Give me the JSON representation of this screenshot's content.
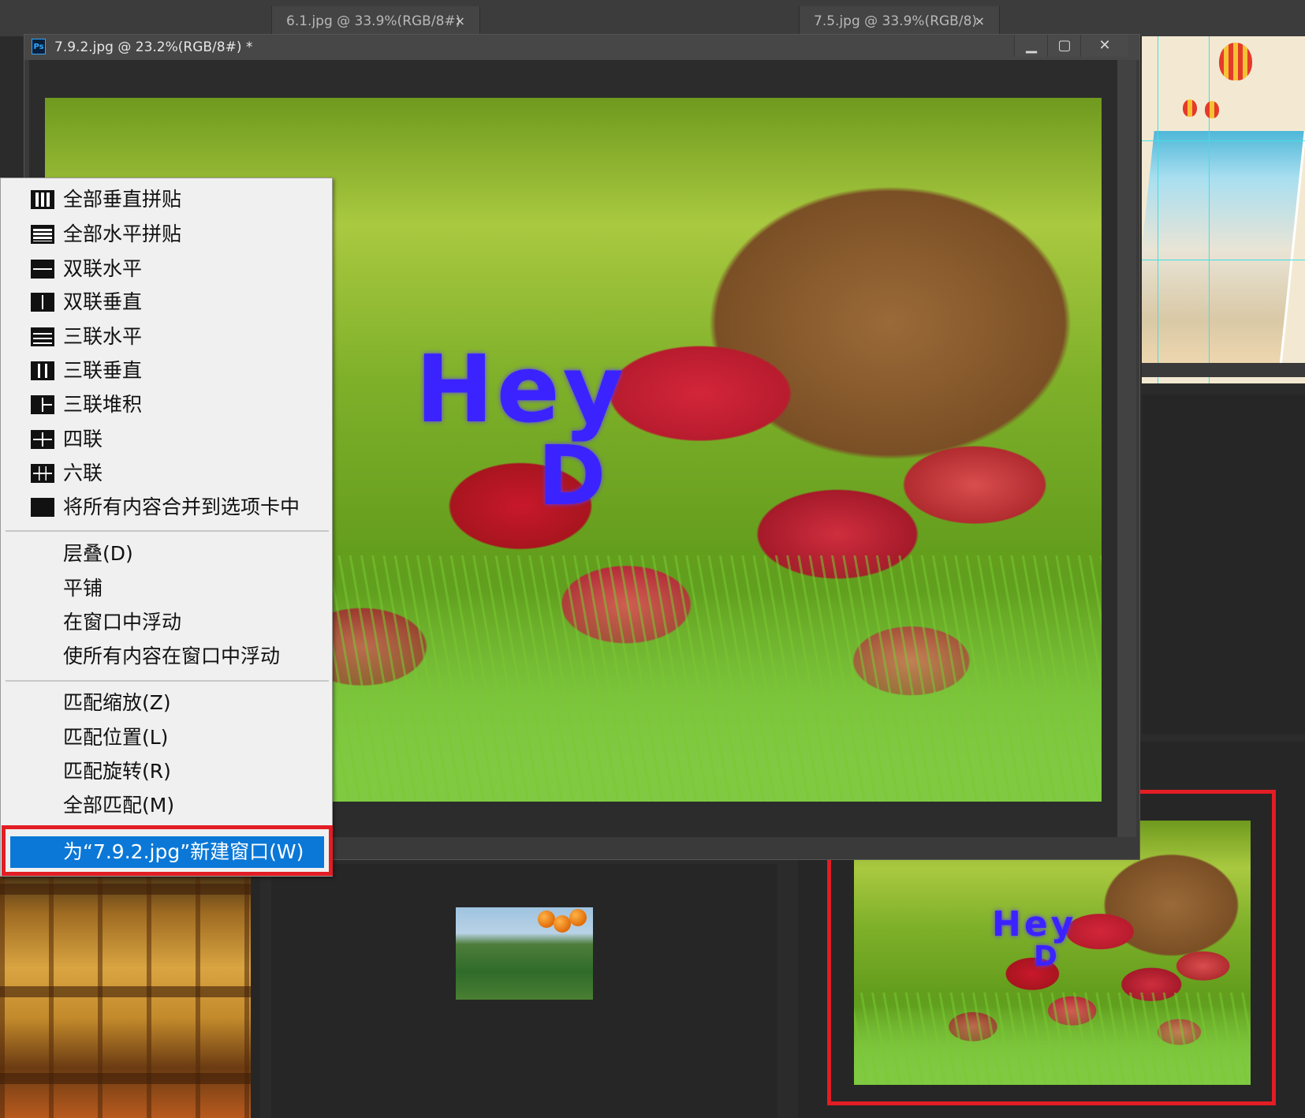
{
  "tabs": [
    {
      "title": "6.1.jpg @ 33.9%(RGB/8#)",
      "close": "×"
    },
    {
      "title": "7.5.jpg @ 33.9%(RGB/8)",
      "close": "×"
    }
  ],
  "document_window": {
    "app_icon": "Ps",
    "title": "7.9.2.jpg @ 23.2%(RGB/8#) *",
    "controls": {
      "minimize": "▁",
      "maximize": "▢",
      "close": "✕"
    }
  },
  "canvas_text": {
    "line1": "Hey",
    "line2": "D"
  },
  "context_menu": {
    "group1": [
      {
        "label": "全部垂直拼贴",
        "icon": "tile-all-vertical-icon"
      },
      {
        "label": "全部水平拼贴",
        "icon": "tile-all-horizontal-icon"
      },
      {
        "label": "双联水平",
        "icon": "2-up-horizontal-icon"
      },
      {
        "label": "双联垂直",
        "icon": "2-up-vertical-icon"
      },
      {
        "label": "三联水平",
        "icon": "3-up-horizontal-icon"
      },
      {
        "label": "三联垂直",
        "icon": "3-up-vertical-icon"
      },
      {
        "label": "三联堆积",
        "icon": "3-up-stacked-icon"
      },
      {
        "label": "四联",
        "icon": "4-up-icon"
      },
      {
        "label": "六联",
        "icon": "6-up-icon"
      },
      {
        "label": "将所有内容合并到选项卡中",
        "icon": "consolidate-tabs-icon"
      }
    ],
    "group2": [
      {
        "label": "层叠(D)"
      },
      {
        "label": "平铺"
      },
      {
        "label": "在窗口中浮动"
      },
      {
        "label": "使所有内容在窗口中浮动"
      }
    ],
    "group3": [
      {
        "label": "匹配缩放(Z)"
      },
      {
        "label": "匹配位置(L)"
      },
      {
        "label": "匹配旋转(R)"
      },
      {
        "label": "全部匹配(M)"
      }
    ],
    "selected_item": {
      "label": "为“7.9.2.jpg”新建窗口(W)"
    }
  },
  "colors": {
    "highlight": "#0b78d7",
    "annotation_red": "#e21d24",
    "text_blue": "#3b23ff"
  }
}
